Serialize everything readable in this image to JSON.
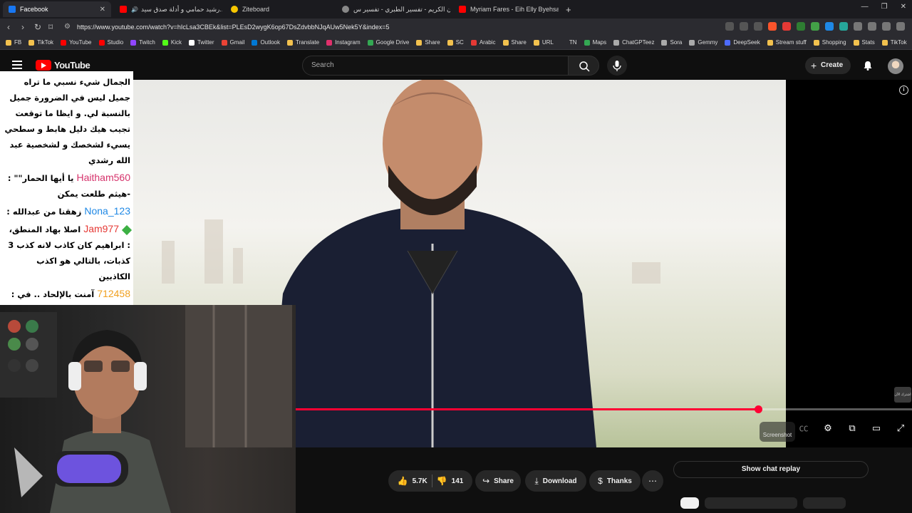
{
  "browser": {
    "tabs": [
      {
        "label": "Facebook",
        "color": "#1877f2",
        "active": true
      },
      {
        "label": "رشيد حمامي و أدلة صدق سيد...",
        "color": "#ff0000",
        "active": false
      },
      {
        "label": "Ziteboard",
        "color": "#f7c600",
        "active": false
      },
      {
        "label": "القرآن الكريم - تفسير الطبري - تفسير س...",
        "color": "#888888",
        "active": false
      },
      {
        "label": "Myriam Fares - Eih Elly Byehsal / ...عيش",
        "color": "#ff0000",
        "active": false
      }
    ],
    "new_tab": "+",
    "url": "https://www.youtube.com/watch?v=hIcLsa3CBEk&list=PLEsD2wygK6op67DsZdvbbNJqAUw5Nek5Y&index=5",
    "bookmarks": [
      {
        "label": "FB",
        "color": "#f2c14e"
      },
      {
        "label": "TikTok",
        "color": "#f2c14e"
      },
      {
        "label": "YouTube",
        "color": "#ff0000"
      },
      {
        "label": "Studio",
        "color": "#ff0000"
      },
      {
        "label": "Twitch",
        "color": "#9146ff"
      },
      {
        "label": "Kick",
        "color": "#53fc18"
      },
      {
        "label": "Twitter",
        "color": "#ffffff"
      },
      {
        "label": "Gmail",
        "color": "#ea4335"
      },
      {
        "label": "Outlook",
        "color": "#0078d4"
      },
      {
        "label": "Translate",
        "color": "#f2c14e"
      },
      {
        "label": "Instagram",
        "color": "#e1306c"
      },
      {
        "label": "Google Drive",
        "color": "#34a853"
      },
      {
        "label": "Share",
        "color": "#f2c14e"
      },
      {
        "label": "SC",
        "color": "#f2c14e"
      },
      {
        "label": "Arabic",
        "color": "#e53935"
      },
      {
        "label": "Share",
        "color": "#f2c14e"
      },
      {
        "label": "URL",
        "color": "#f2c14e"
      },
      {
        "label": "TN",
        "color": "#2b2b30"
      },
      {
        "label": "Maps",
        "color": "#34a853"
      },
      {
        "label": "ChatGPTeez",
        "color": "#aaaaaa"
      },
      {
        "label": "Sora",
        "color": "#aaaaaa"
      },
      {
        "label": "Gemmy",
        "color": "#aaaaaa"
      },
      {
        "label": "DeepSeek",
        "color": "#4d6bfe"
      },
      {
        "label": "Stream stuff",
        "color": "#f2c14e"
      },
      {
        "label": "Shopping",
        "color": "#f2c14e"
      },
      {
        "label": "Stats",
        "color": "#f2c14e"
      },
      {
        "label": "TikTok",
        "color": "#f2c14e"
      }
    ]
  },
  "youtube": {
    "logo_text": "YouTube",
    "search_placeholder": "Search",
    "create_label": "Create",
    "progress_fraction": 0.75,
    "screenshot_label": "Screenshot",
    "side_chip_label": "اشترك الآن",
    "actions": {
      "likes": "5.7K",
      "dislikes": "141",
      "share": "Share",
      "download": "Download",
      "thanks": "Thanks"
    },
    "chat_replay": "Show chat replay"
  },
  "chat": {
    "messages": [
      {
        "user": "",
        "user_color": "#000000",
        "text": "الجمال شيء نسبي ما تراه جميل ليس في الضرورة جميل بالنسبة لي. و ايظا ما توقعت تجيب هيك دليل هابط و سطحي يسيء لشخصك و لشخصية عبد الله رشدي"
      },
      {
        "user": "Haitham560",
        "user_color": "#d6336c",
        "text": "يا أيها الحمار\"\" : -هيثم طلعت يمكن"
      },
      {
        "user": "Nona_123",
        "user_color": "#1e88e5",
        "text": "زهقنا من عبدالله :"
      },
      {
        "user": "Jam977",
        "user_color": "#e53935",
        "badge": true,
        "text": "اصلا بهاد المنطق، : ابراهيم كان كاذب لانه كذب 3 كذبات، بالتالي هو اكذب الكاذبين"
      },
      {
        "user": "712458",
        "user_color": "#f0a020",
        "text": "آمنت بالإلحاد .. في : شهادتين وغسل قبل الرجس والجنس والخمور؟"
      }
    ]
  }
}
